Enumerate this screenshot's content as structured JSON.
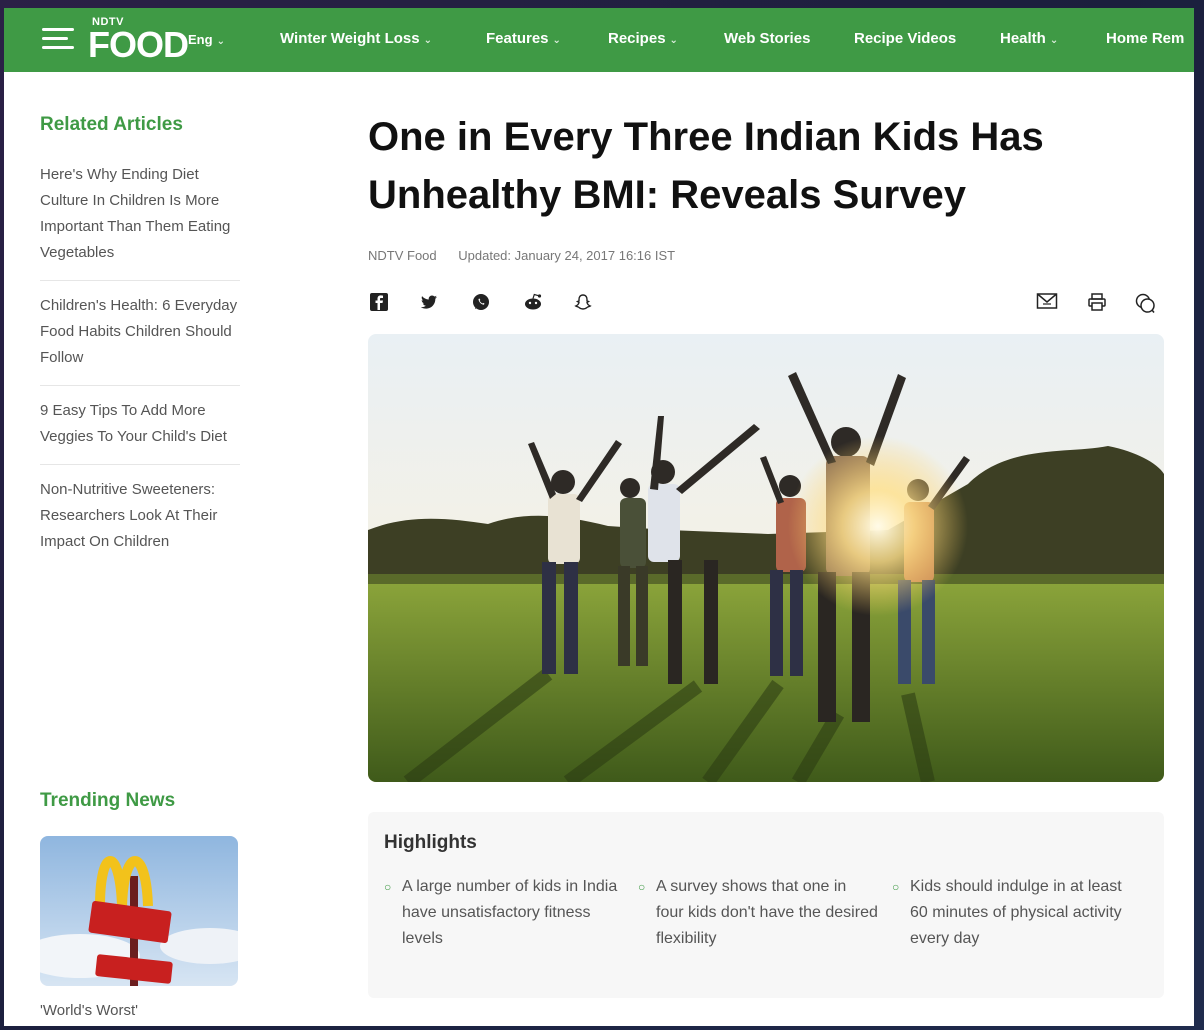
{
  "nav": {
    "logo_top": "NDTV",
    "logo_main": "FOOD",
    "language": "Eng",
    "items": [
      {
        "label": "Winter Weight Loss",
        "has_dropdown": true
      },
      {
        "label": "Features",
        "has_dropdown": true
      },
      {
        "label": "Recipes",
        "has_dropdown": true
      },
      {
        "label": "Web Stories",
        "has_dropdown": false
      },
      {
        "label": "Recipe Videos",
        "has_dropdown": false
      },
      {
        "label": "Health",
        "has_dropdown": true
      },
      {
        "label": "Home Rem",
        "has_dropdown": false
      }
    ]
  },
  "sidebar": {
    "related_heading": "Related Articles",
    "related": [
      "Here's Why Ending Diet Culture In Children Is More Important Than Them Eating Vegetables",
      "Children's Health: 6 Everyday Food Habits Children Should Follow",
      "9 Easy Tips To Add More Veggies To Your Child's Diet",
      "Non-Nutritive Sweeteners: Researchers Look At Their Impact On Children"
    ],
    "trending_heading": "Trending News",
    "trending_caption": "'World's Worst'"
  },
  "article": {
    "title": "One in Every Three Indian Kids Has Unhealthy BMI: Reveals Survey",
    "source": "NDTV Food",
    "updated": "Updated: January 24, 2017 16:16 IST"
  },
  "share_icons": [
    "facebook-icon",
    "twitter-icon",
    "whatsapp-icon",
    "reddit-icon",
    "snapchat-icon",
    "mail-icon",
    "print-icon",
    "comment-icon"
  ],
  "highlights": {
    "title": "Highlights",
    "items": [
      "A large number of kids in India have unsatisfactory fitness levels",
      "A survey shows that one in four kids don't have the desired flexibility",
      "Kids should indulge in at least 60 minutes of physical activity every day"
    ]
  },
  "colors": {
    "brand_green": "#3f9a45",
    "title_text": "#111111"
  }
}
